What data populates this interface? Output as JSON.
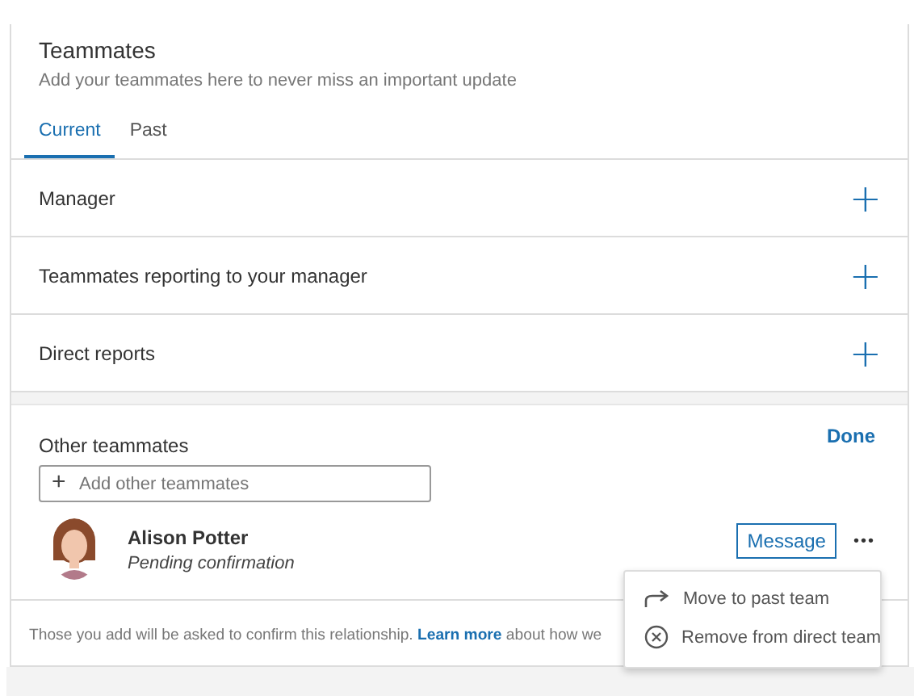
{
  "header": {
    "title": "Teammates",
    "subtitle": "Add your teammates here to never miss an important update"
  },
  "tabs": [
    {
      "label": "Current",
      "selected": true
    },
    {
      "label": "Past",
      "selected": false
    }
  ],
  "groups": [
    {
      "label": "Manager",
      "add_icon": "+"
    },
    {
      "label": "Teammates reporting to your manager",
      "add_icon": "+"
    },
    {
      "label": "Direct reports",
      "add_icon": "+"
    }
  ],
  "other": {
    "title": "Other teammates",
    "done": "Done",
    "add_field": {
      "icon": "+",
      "placeholder": "Add other teammates"
    },
    "people": [
      {
        "name": "Alison Potter",
        "status": "Pending confirmation",
        "action": "Message",
        "more": "•••"
      }
    ]
  },
  "footer": {
    "text": "Those you add will be asked to confirm this relationship.",
    "link": "Learn more",
    "rest": "about how we"
  },
  "menu": [
    {
      "kind": "move",
      "label": "Move to past team"
    },
    {
      "kind": "remove",
      "label": "Remove from direct team"
    }
  ]
}
